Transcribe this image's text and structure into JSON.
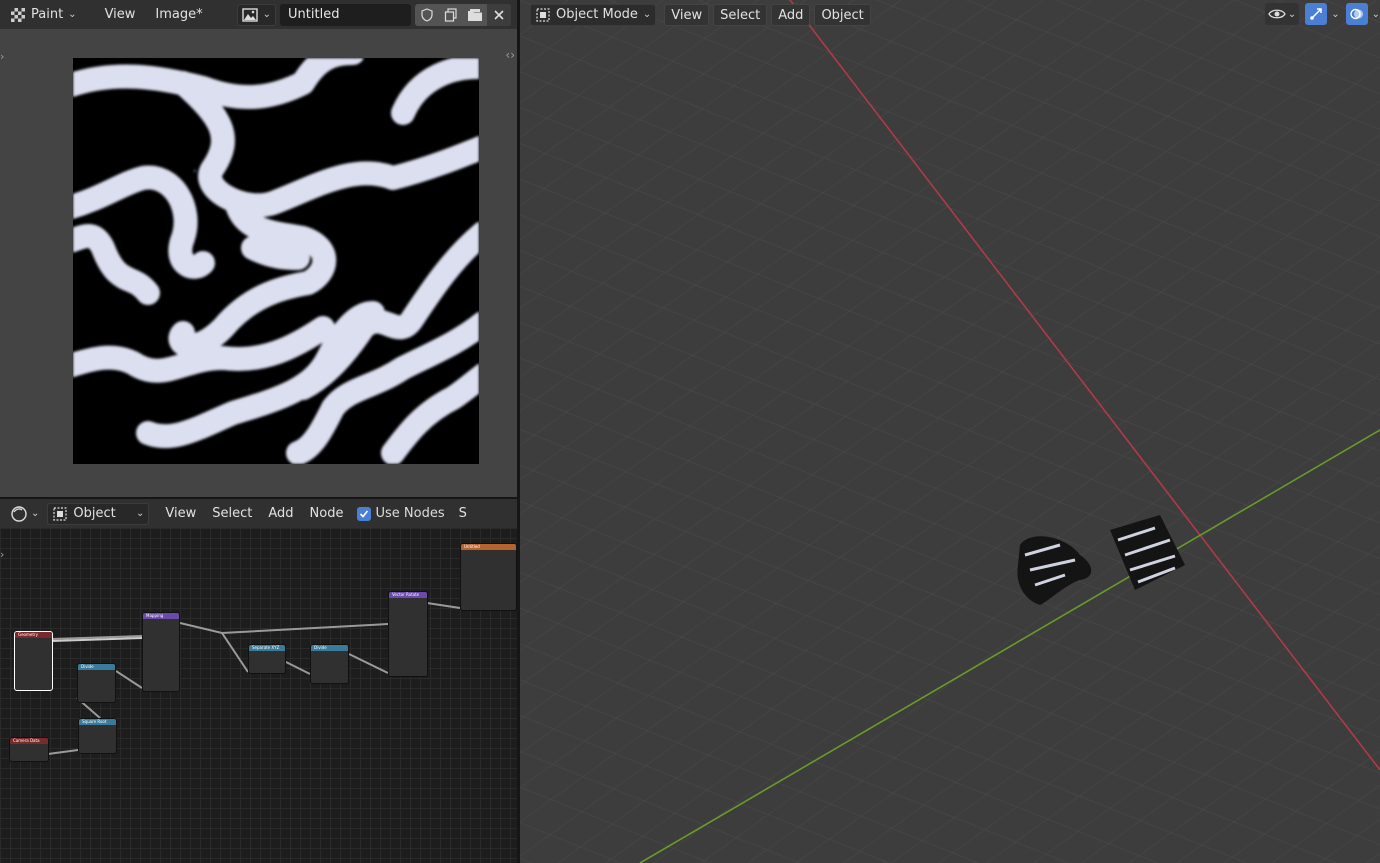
{
  "image_editor": {
    "workspace_label": "Paint",
    "menus": [
      "View",
      "Image*"
    ],
    "image_name": "Untitled"
  },
  "node_editor": {
    "shader_type": "Object",
    "menus": [
      "View",
      "Select",
      "Add",
      "Node"
    ],
    "use_nodes_label": "Use Nodes",
    "use_nodes_checked": true,
    "overflow_label": "S",
    "nodes": [
      {
        "title": "Geometry",
        "color": "#7a2a2a"
      },
      {
        "title": "Divide",
        "color": "#3a7a9a"
      },
      {
        "title": "Mapping",
        "color": "#6a4aaa"
      },
      {
        "title": "Separate XYZ",
        "color": "#3a7a9a"
      },
      {
        "title": "Divide",
        "color": "#3a7a9a"
      },
      {
        "title": "Vector Rotate",
        "color": "#6a4aaa"
      },
      {
        "title": "Untitled",
        "color": "#b8632e"
      },
      {
        "title": "Square Root",
        "color": "#3a7a9a"
      },
      {
        "title": "Camera Data",
        "color": "#7a2a2a"
      }
    ]
  },
  "viewport": {
    "mode": "Object Mode",
    "menus": [
      "View",
      "Select",
      "Add",
      "Object"
    ],
    "x_axis_color": "#b03a48",
    "y_axis_color": "#6a9a2a"
  }
}
